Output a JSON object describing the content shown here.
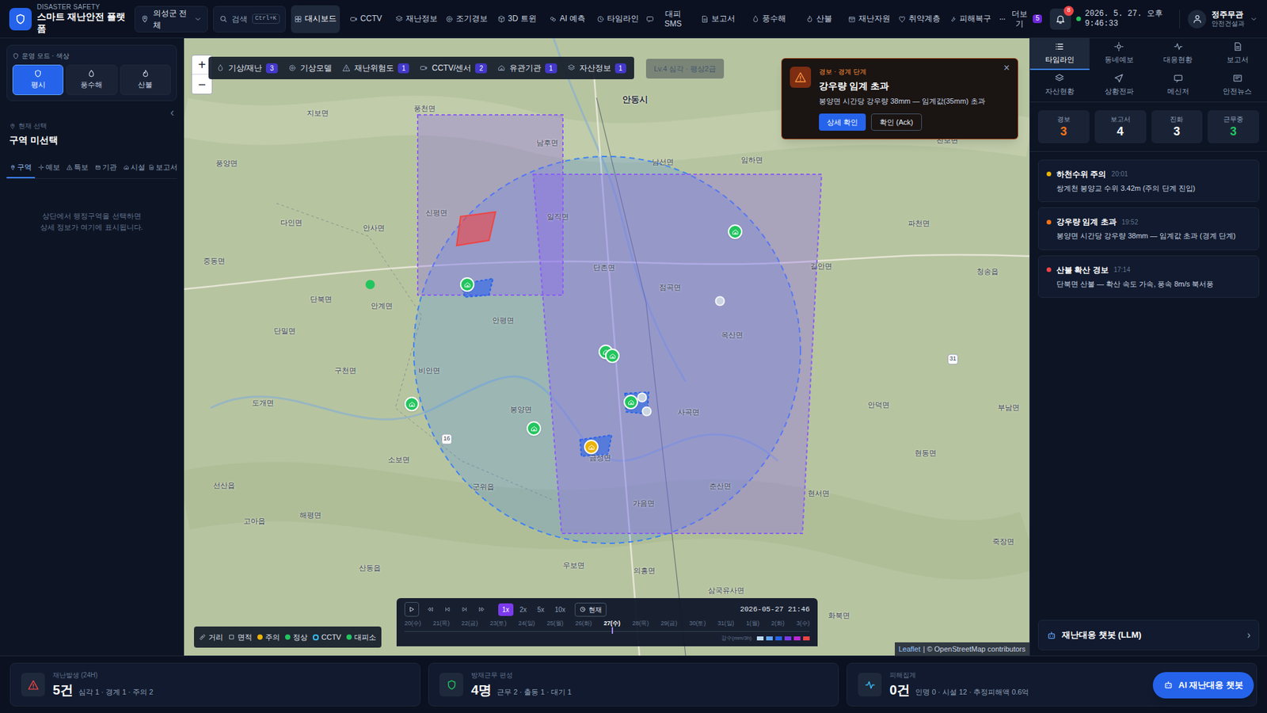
{
  "header": {
    "brand_small": "DISASTER SAFETY",
    "brand": "스마트 재난안전 플랫폼",
    "region": "의성군 전체",
    "search": "검색",
    "search_key": "Ctrl+K",
    "nav": [
      {
        "label": "대시보드",
        "selected": true
      },
      {
        "label": "CCTV",
        "selected": false
      },
      {
        "label": "재난정보",
        "selected": false
      },
      {
        "label": "조기경보",
        "selected": false
      },
      {
        "label": "3D 트윈",
        "selected": false
      },
      {
        "label": "AI 예측",
        "selected": false
      },
      {
        "label": "타임라인",
        "selected": false
      },
      {
        "label": "대피 SMS",
        "selected": false
      },
      {
        "label": "보고서",
        "selected": false
      },
      {
        "label": "풍수해",
        "selected": false
      },
      {
        "label": "산불",
        "selected": false
      },
      {
        "label": "재난자원",
        "selected": false
      },
      {
        "label": "취약계층",
        "selected": false
      },
      {
        "label": "피해복구",
        "selected": false
      },
      {
        "label": "더보기",
        "selected": false,
        "badge": "5"
      }
    ],
    "notifications": "8",
    "clock": "2026. 5. 27. 오후 9:46:33",
    "user_name": "정주무관",
    "user_dept": "안전건설과"
  },
  "sidebar": {
    "mode_title": "운영 모드 · 색상",
    "modes": [
      {
        "label": "평시",
        "selected": true
      },
      {
        "label": "풍수해",
        "selected": false
      },
      {
        "label": "산불",
        "selected": false
      }
    ],
    "collapse": "‹",
    "current_label": "현재 선택",
    "current_value": "구역 미선택",
    "tabs": [
      {
        "label": "구역",
        "selected": true
      },
      {
        "label": "예보",
        "selected": false
      },
      {
        "label": "특보",
        "selected": false
      },
      {
        "label": "기관",
        "selected": false
      },
      {
        "label": "시설",
        "selected": false
      },
      {
        "label": "보고서",
        "selected": false
      }
    ],
    "empty": "상단에서 행정구역을 선택하면\n상세 정보가 여기에 표시됩니다."
  },
  "map": {
    "zoom_in": "+",
    "zoom_out": "−",
    "layers": [
      {
        "label": "기상/재난",
        "count": "3"
      },
      {
        "label": "기상모델"
      },
      {
        "label": "재난위험도",
        "count": "1"
      },
      {
        "label": "CCTV/센서",
        "count": "2"
      },
      {
        "label": "유관기관",
        "count": "1"
      },
      {
        "label": "자산정보",
        "count": "1"
      }
    ],
    "level_chip": "Lv.4 심각 · 평상2급",
    "alert": {
      "tag": "경보 · 경계 단계",
      "title": "강우량 임계 초과",
      "desc": "봉양면 시간당 강우량 38mm — 임계값(35mm) 초과",
      "primary": "상세 확인",
      "secondary": "확인 (Ack)",
      "close": "×"
    },
    "labels": [
      {
        "text": "풍천면",
        "kind": "place"
      },
      {
        "text": "지보면",
        "kind": "place"
      },
      {
        "text": "남후면",
        "kind": "place"
      },
      {
        "text": "안동시",
        "kind": "city"
      },
      {
        "text": "임하면",
        "kind": "place"
      },
      {
        "text": "진보면",
        "kind": "place"
      },
      {
        "text": "풍양면",
        "kind": "place"
      },
      {
        "text": "다인면",
        "kind": "place"
      },
      {
        "text": "신평면",
        "kind": "place"
      },
      {
        "text": "일직면",
        "kind": "place"
      },
      {
        "text": "남선면",
        "kind": "place"
      },
      {
        "text": "파천면",
        "kind": "place"
      },
      {
        "text": "안사면",
        "kind": "place"
      },
      {
        "text": "단촌면",
        "kind": "place"
      },
      {
        "text": "길안면",
        "kind": "place"
      },
      {
        "text": "청송읍",
        "kind": "place"
      },
      {
        "text": "중동면",
        "kind": "place"
      },
      {
        "text": "단북면",
        "kind": "place"
      },
      {
        "text": "안계면",
        "kind": "place"
      },
      {
        "text": "점곡면",
        "kind": "place"
      },
      {
        "text": "단밀면",
        "kind": "place"
      },
      {
        "text": "안평면",
        "kind": "place"
      },
      {
        "text": "옥산면",
        "kind": "place"
      },
      {
        "text": "구천면",
        "kind": "place"
      },
      {
        "text": "비안면",
        "kind": "place"
      },
      {
        "text": "도개면",
        "kind": "place"
      },
      {
        "text": "봉양면",
        "kind": "place"
      },
      {
        "text": "사곡면",
        "kind": "place"
      },
      {
        "text": "안덕면",
        "kind": "place"
      },
      {
        "text": "부남면",
        "kind": "place"
      },
      {
        "text": "소보면",
        "kind": "place"
      },
      {
        "text": "금성면",
        "kind": "place"
      },
      {
        "text": "현동면",
        "kind": "place"
      },
      {
        "text": "선산읍",
        "kind": "place"
      },
      {
        "text": "군위읍",
        "kind": "place"
      },
      {
        "text": "춘산면",
        "kind": "place"
      },
      {
        "text": "해평면",
        "kind": "place"
      },
      {
        "text": "가음면",
        "kind": "place"
      },
      {
        "text": "현서면",
        "kind": "place"
      },
      {
        "text": "고아읍",
        "kind": "place"
      },
      {
        "text": "산동읍",
        "kind": "place"
      },
      {
        "text": "우보면",
        "kind": "place"
      },
      {
        "text": "의흥면",
        "kind": "place"
      },
      {
        "text": "삼국유사면",
        "kind": "place"
      },
      {
        "text": "화북면",
        "kind": "place"
      },
      {
        "text": "죽장면",
        "kind": "place"
      },
      {
        "text": "31",
        "kind": "road"
      },
      {
        "text": "16",
        "kind": "road"
      }
    ],
    "zones": [
      {
        "kind": "circle",
        "color": "#3b82f6"
      },
      {
        "kind": "rect",
        "color": "#8b5cf6"
      },
      {
        "kind": "poly",
        "color": "#8b5cf6"
      },
      {
        "kind": "risk",
        "color": "#ef4444"
      },
      {
        "kind": "small",
        "color": "#2563eb"
      },
      {
        "kind": "small",
        "color": "#2563eb"
      },
      {
        "kind": "small",
        "color": "#2563eb"
      }
    ],
    "markers": [
      {
        "kind": "shelter",
        "color": "#22c55e"
      },
      {
        "kind": "shelter",
        "color": "#22c55e"
      },
      {
        "kind": "shelter",
        "color": "#22c55e"
      },
      {
        "kind": "shelter",
        "color": "#22c55e"
      },
      {
        "kind": "shelter",
        "color": "#22c55e"
      },
      {
        "kind": "shelter",
        "color": "#22c55e"
      },
      {
        "kind": "shelter",
        "color": "#22c55e"
      },
      {
        "kind": "shelter",
        "color": "#eab308"
      },
      {
        "kind": "sensor",
        "color": "#cbd5e1"
      },
      {
        "kind": "sensor",
        "color": "#cbd5e1"
      },
      {
        "kind": "sensor",
        "color": "#cbd5e1"
      },
      {
        "kind": "point",
        "color": "#22c55e"
      }
    ],
    "legend": [
      {
        "label": "거리",
        "kind": "ruler"
      },
      {
        "label": "면적",
        "kind": "area"
      },
      {
        "label": "주의",
        "kind": "dot",
        "color": "#eab308"
      },
      {
        "label": "정상",
        "kind": "dot",
        "color": "#22c55e"
      },
      {
        "label": "CCTV",
        "kind": "cctv",
        "color": "#38bdf8"
      },
      {
        "label": "대피소",
        "kind": "dot",
        "color": "#22c55e"
      }
    ],
    "timeline": {
      "speeds": [
        {
          "label": "1x",
          "selected": true
        },
        {
          "label": "2x",
          "selected": false
        },
        {
          "label": "5x",
          "selected": false
        },
        {
          "label": "10x",
          "selected": false
        }
      ],
      "now": "현재",
      "datetime": "2026-05-27 21:46",
      "days": [
        {
          "label": "20(수)",
          "selected": false
        },
        {
          "label": "21(목)",
          "selected": false
        },
        {
          "label": "22(금)",
          "selected": false
        },
        {
          "label": "23(토)",
          "selected": false
        },
        {
          "label": "24(일)",
          "selected": false
        },
        {
          "label": "25(월)",
          "selected": false
        },
        {
          "label": "26(화)",
          "selected": false
        },
        {
          "label": "27(수)",
          "selected": true
        },
        {
          "label": "28(목)",
          "selected": false
        },
        {
          "label": "29(금)",
          "selected": false
        },
        {
          "label": "30(토)",
          "selected": false
        },
        {
          "label": "31(일)",
          "selected": false
        },
        {
          "label": "1(월)",
          "selected": false
        },
        {
          "label": "2(화)",
          "selected": false
        },
        {
          "label": "3(수)",
          "selected": false
        }
      ],
      "rain_label": "강수(mm/3h)",
      "rain_colors": [
        {
          "color": "#bfdbfe"
        },
        {
          "color": "#60a5fa"
        },
        {
          "color": "#2563eb"
        },
        {
          "color": "#7c3aed"
        },
        {
          "color": "#c026d3"
        },
        {
          "color": "#ef4444"
        }
      ]
    },
    "attribution": {
      "leaflet": "Leaflet",
      "osm": "| © OpenStreetMap contributors"
    }
  },
  "panel": {
    "tabs": [
      {
        "label": "타임라인",
        "selected": true
      },
      {
        "label": "동네예보",
        "selected": false
      },
      {
        "label": "대응현황",
        "selected": false
      },
      {
        "label": "보고서",
        "selected": false
      },
      {
        "label": "자산현황",
        "selected": false
      },
      {
        "label": "상황전파",
        "selected": false
      },
      {
        "label": "메신저",
        "selected": false
      },
      {
        "label": "안전뉴스",
        "selected": false
      }
    ],
    "stats": [
      {
        "label": "경보",
        "value": "3",
        "color": "#f97316"
      },
      {
        "label": "보고서",
        "value": "4",
        "color": "#f8fafc"
      },
      {
        "label": "진화",
        "value": "3",
        "color": "#f8fafc"
      },
      {
        "label": "근무중",
        "value": "3",
        "color": "#22c55e"
      }
    ],
    "events": [
      {
        "title": "하천수위 주의",
        "time": "20:01",
        "desc": "쌍계천 봉양교 수위 3.42m (주의 단계 진입)",
        "color": "#eab308"
      },
      {
        "title": "강우량 임계 초과",
        "time": "19:52",
        "desc": "봉양면 시간당 강우량 38mm — 임계값 초과 (경계 단계)",
        "color": "#f97316"
      },
      {
        "title": "산불 확산 경보",
        "time": "17:14",
        "desc": "단북면 산불 — 확산 속도 가속, 풍속 8m/s 북서풍",
        "color": "#ef4444"
      }
    ],
    "chatbot": "재난대응 챗봇 (LLM)",
    "chatbot_arrow": "›"
  },
  "footer": {
    "cards": [
      {
        "label": "재난발생 (24H)",
        "value": "5건",
        "detail": "심각 1 · 경계 1 · 주의 2",
        "color": "#ef4444"
      },
      {
        "label": "방재근무 편성",
        "value": "4명",
        "detail": "근무 2 · 출동 1 · 대기 1",
        "color": "#22c55e"
      },
      {
        "label": "피해집계",
        "value": "0건",
        "detail": "인명 0 · 시설 12 · 추정피해액 0.6억",
        "color": "#38bdf8"
      }
    ],
    "ai_button": "AI 재난대응 챗봇"
  }
}
